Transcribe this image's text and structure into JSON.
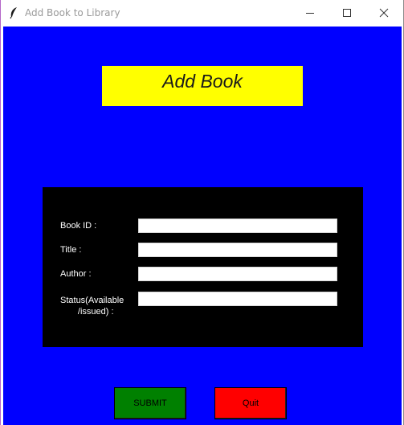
{
  "window": {
    "title": "Add Book to Library",
    "controls": {
      "minimize_icon": "minimize-icon",
      "maximize_icon": "maximize-icon",
      "close_icon": "close-icon"
    }
  },
  "colors": {
    "background": "#0000ff",
    "heading_bg": "#ffff00",
    "form_bg": "#000000",
    "submit_bg": "#008000",
    "quit_bg": "#ff0000"
  },
  "heading": {
    "text": "Add Book"
  },
  "form": {
    "fields": [
      {
        "label": "Book ID :",
        "value": ""
      },
      {
        "label": "Title :",
        "value": ""
      },
      {
        "label": "Author :",
        "value": ""
      },
      {
        "label": "Status(Available\n   /issued) :",
        "value": ""
      }
    ]
  },
  "buttons": {
    "submit": "SUBMIT",
    "quit": "Quit"
  }
}
